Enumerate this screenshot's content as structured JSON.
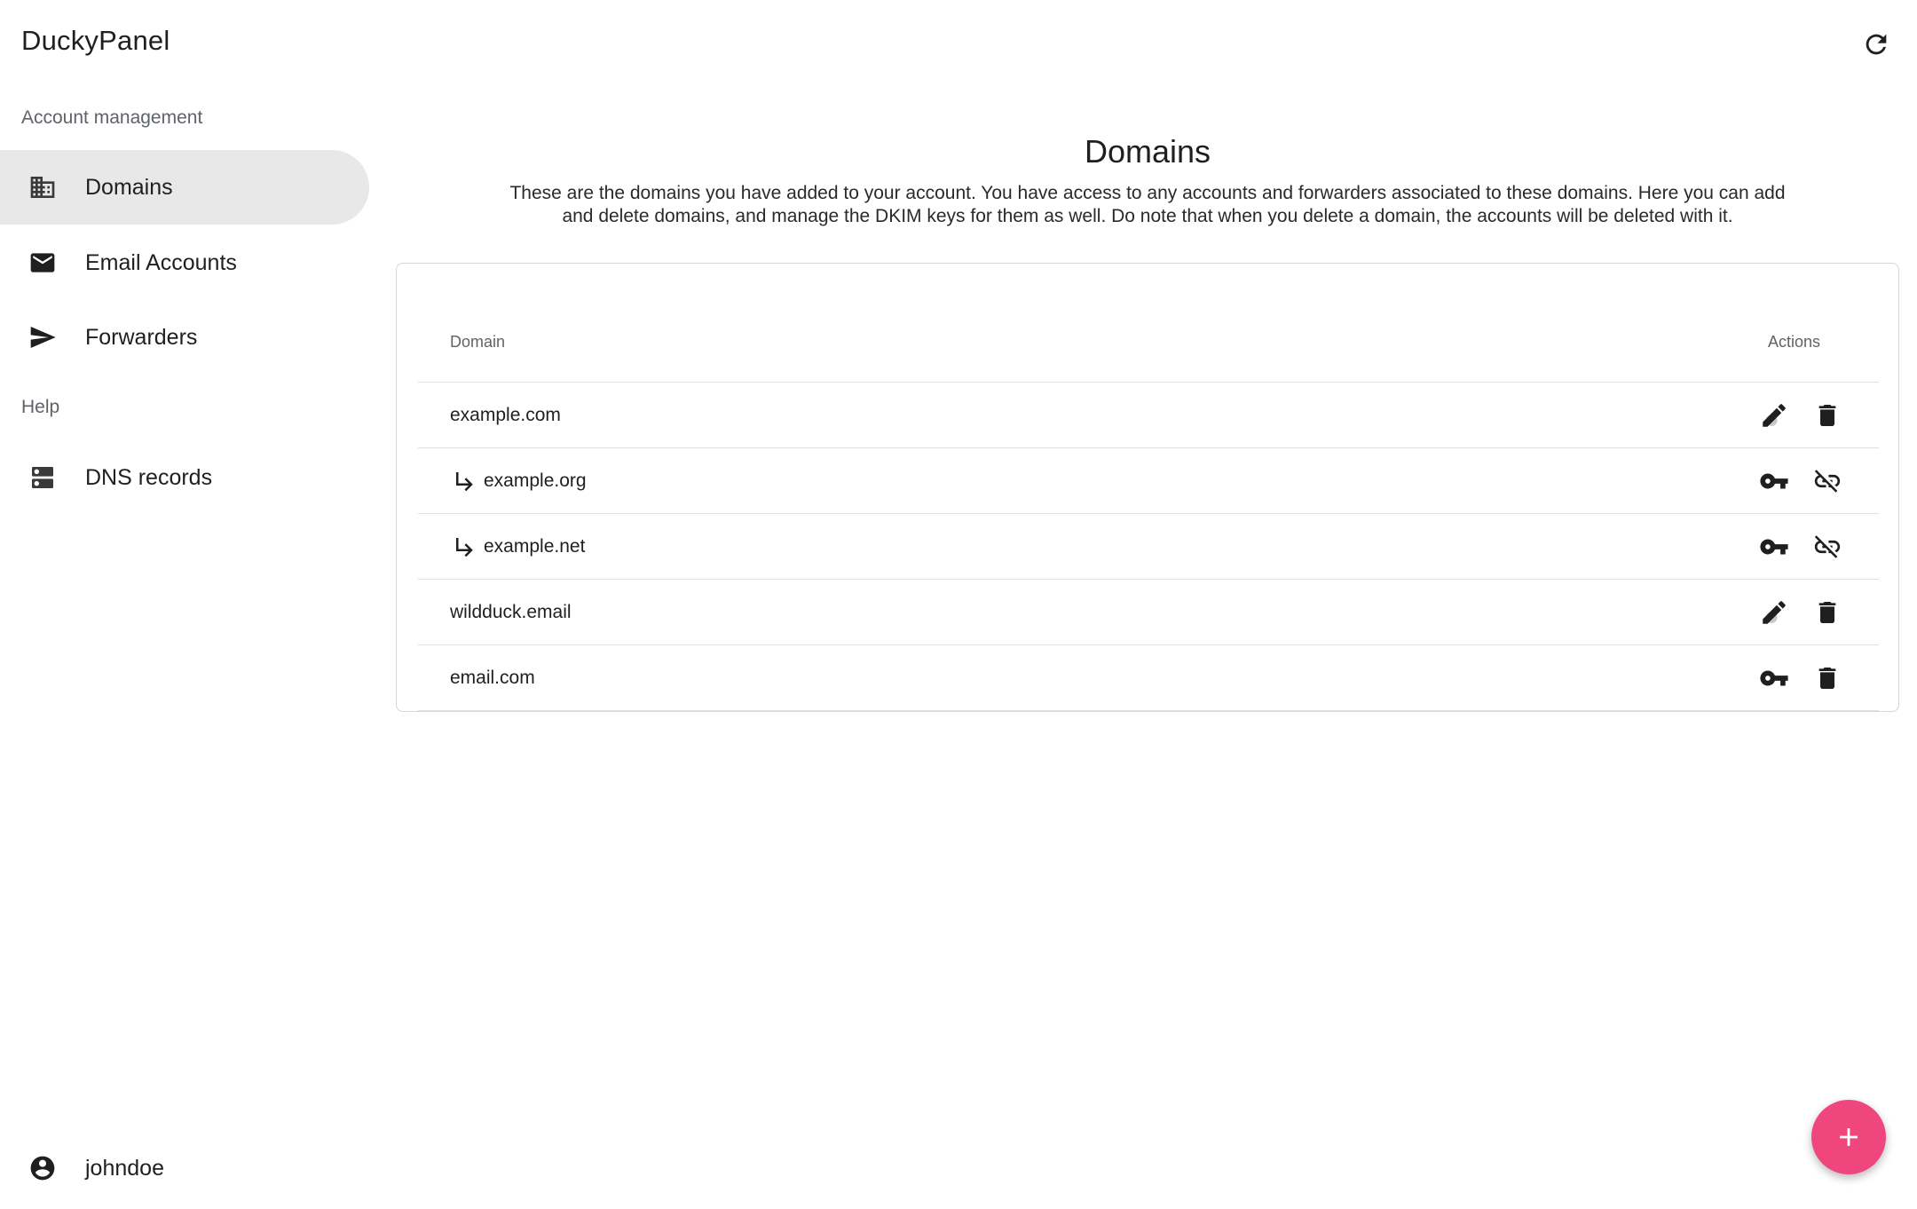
{
  "app": {
    "title": "DuckyPanel"
  },
  "sidebar": {
    "sections": [
      {
        "label": "Account management"
      },
      {
        "label": "Help"
      }
    ],
    "items": [
      {
        "label": "Domains",
        "icon": "domain-icon",
        "active": true
      },
      {
        "label": "Email Accounts",
        "icon": "email-icon",
        "active": false
      },
      {
        "label": "Forwarders",
        "icon": "send-icon",
        "active": false
      },
      {
        "label": "DNS records",
        "icon": "dns-icon",
        "active": false
      }
    ],
    "user": {
      "name": "johndoe",
      "icon": "account-circle-icon"
    }
  },
  "main": {
    "title": "Domains",
    "description": "These are the domains you have added to your account. You have access to any accounts and forwarders associated to these domains. Here you can add and delete domains, and manage the DKIM keys for them as well. Do note that when you delete a domain, the accounts will be deleted with it.",
    "table": {
      "headers": {
        "domain": "Domain",
        "actions": "Actions"
      },
      "rows": [
        {
          "domain": "example.com",
          "alias": false,
          "actions": [
            "edit-dkim-icon",
            "delete-icon"
          ]
        },
        {
          "domain": "example.org",
          "alias": true,
          "actions": [
            "key-icon",
            "unlink-icon"
          ]
        },
        {
          "domain": "example.net",
          "alias": true,
          "actions": [
            "key-icon",
            "unlink-icon"
          ]
        },
        {
          "domain": "wildduck.email",
          "alias": false,
          "actions": [
            "edit-dkim-icon",
            "delete-icon"
          ]
        },
        {
          "domain": "email.com",
          "alias": false,
          "actions": [
            "key-icon",
            "delete-icon"
          ]
        }
      ]
    }
  },
  "colors": {
    "fab": "#f0467e",
    "active_nav": "#e8e8e8"
  }
}
